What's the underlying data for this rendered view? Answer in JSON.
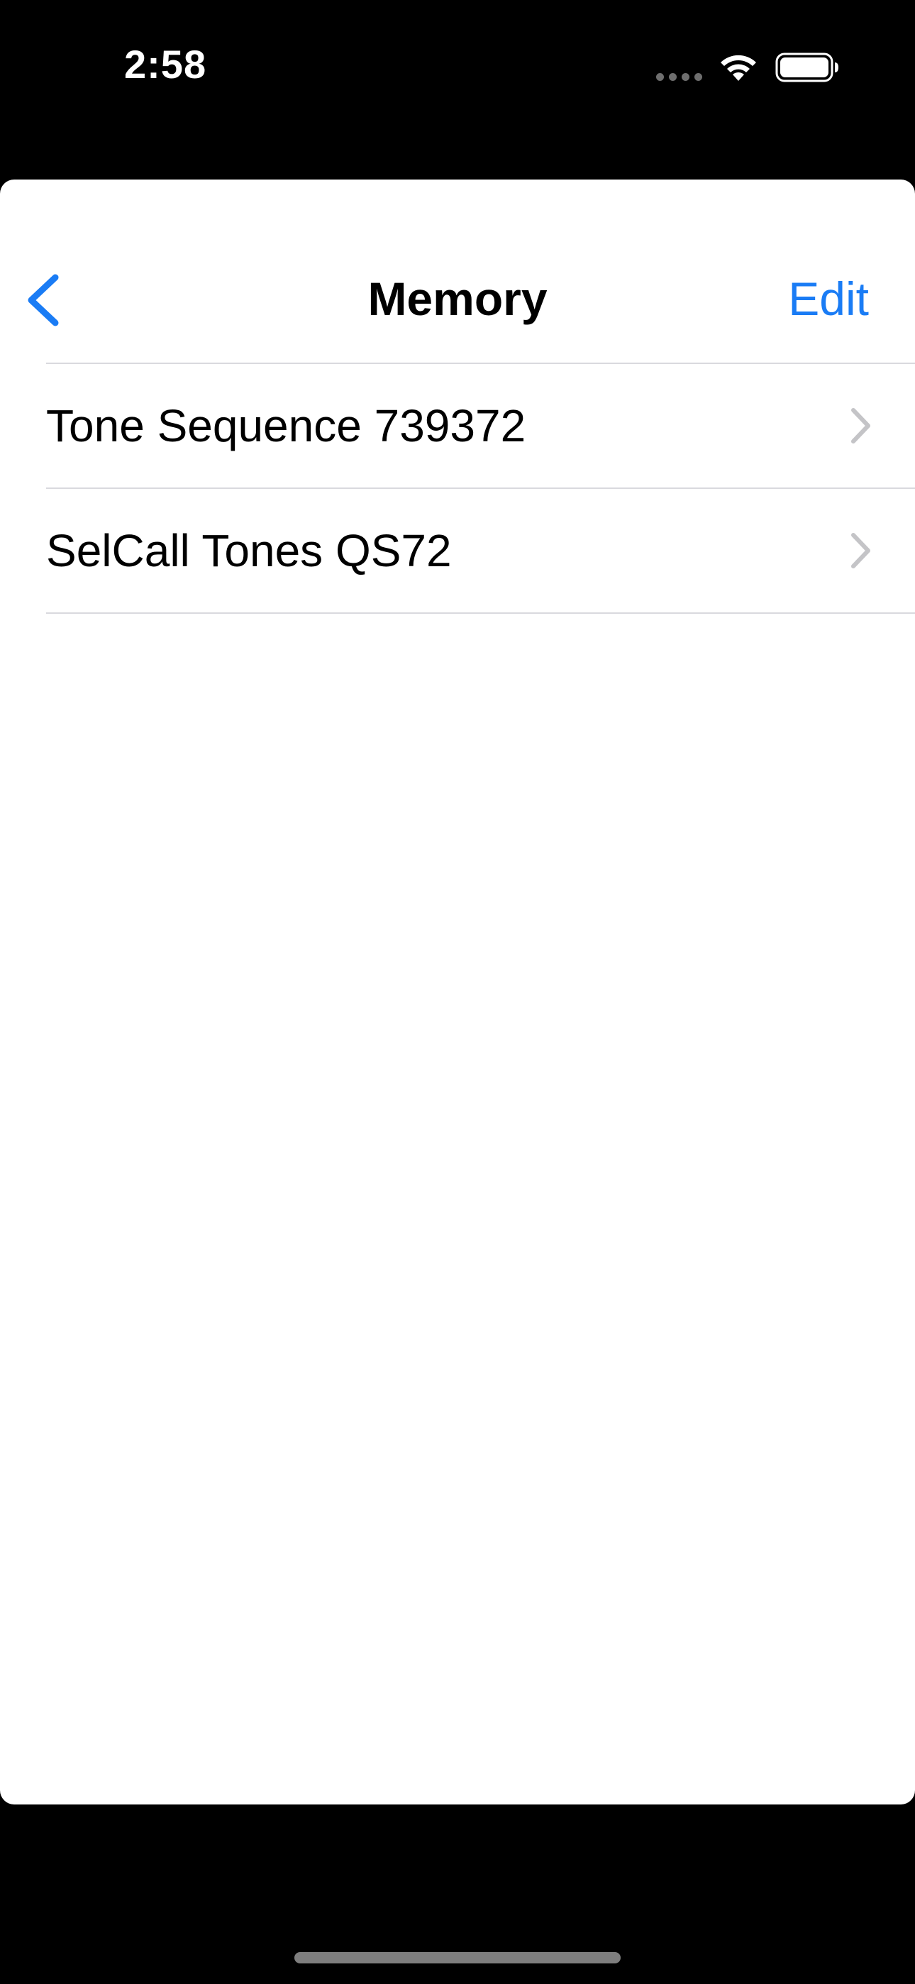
{
  "status_bar": {
    "time": "2:58"
  },
  "nav": {
    "title": "Memory",
    "edit_label": "Edit",
    "back_icon": "chevron-left-icon"
  },
  "list": {
    "items": [
      {
        "label": "Tone Sequence 739372"
      },
      {
        "label": "SelCall Tones QS72"
      }
    ]
  },
  "colors": {
    "accent": "#1a7cf5",
    "separator": "#d9d9de",
    "chevron": "#c4c4c7",
    "background": "#000000",
    "sheet": "#ffffff"
  }
}
